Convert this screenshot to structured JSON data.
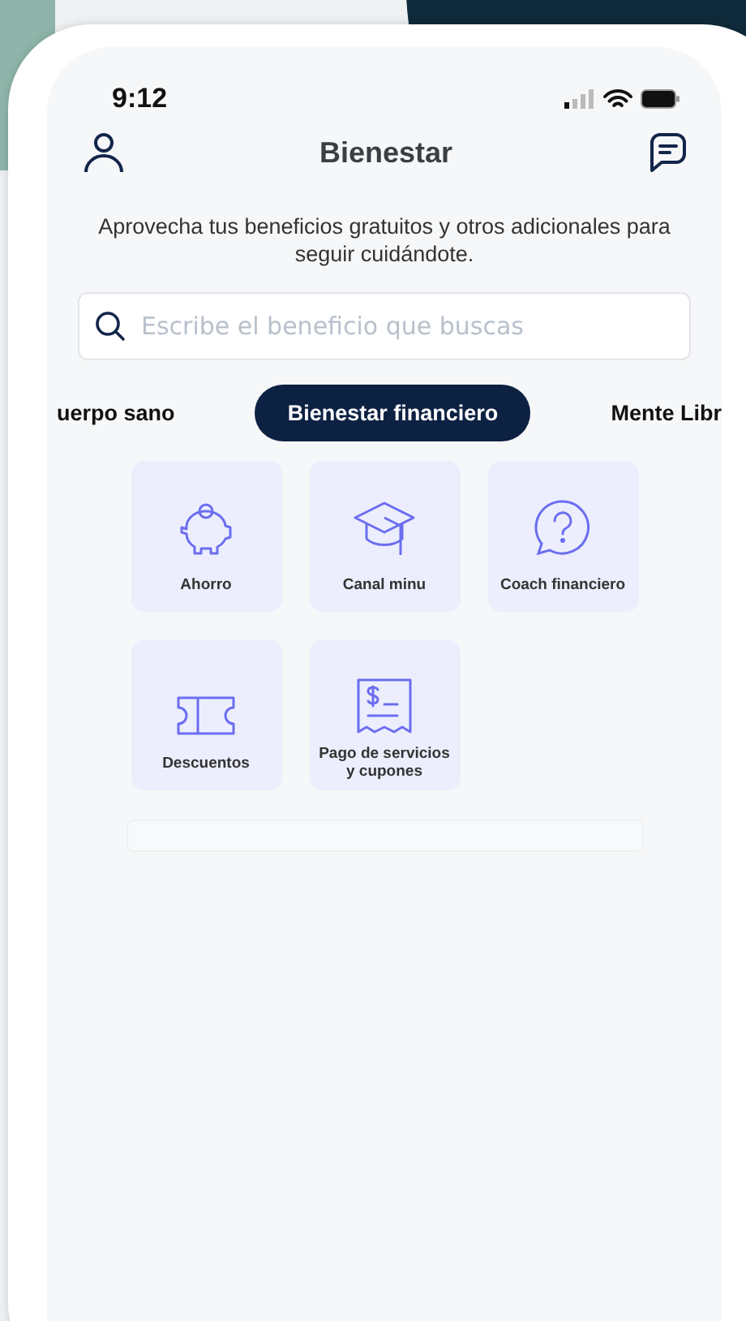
{
  "status_bar": {
    "time": "9:12"
  },
  "header": {
    "title": "Bienestar"
  },
  "intro": "Aprovecha tus beneficios gratuitos y otros adicionales para seguir cuidándote.",
  "search": {
    "placeholder": "Escribe el beneficio que buscas"
  },
  "tabs": [
    {
      "label": "uerpo sano",
      "selected": false
    },
    {
      "label": "Bienestar financiero",
      "selected": true
    },
    {
      "label": "Mente Libr",
      "selected": false
    }
  ],
  "benefits": [
    {
      "label": "Ahorro",
      "kind": "piggy"
    },
    {
      "label": "Canal minu",
      "kind": "cap"
    },
    {
      "label": "Coach financiero",
      "kind": "question"
    },
    {
      "label": "Descuentos",
      "kind": "ticket"
    },
    {
      "label": "Pago de servicios y cupones",
      "kind": "receipt"
    }
  ]
}
